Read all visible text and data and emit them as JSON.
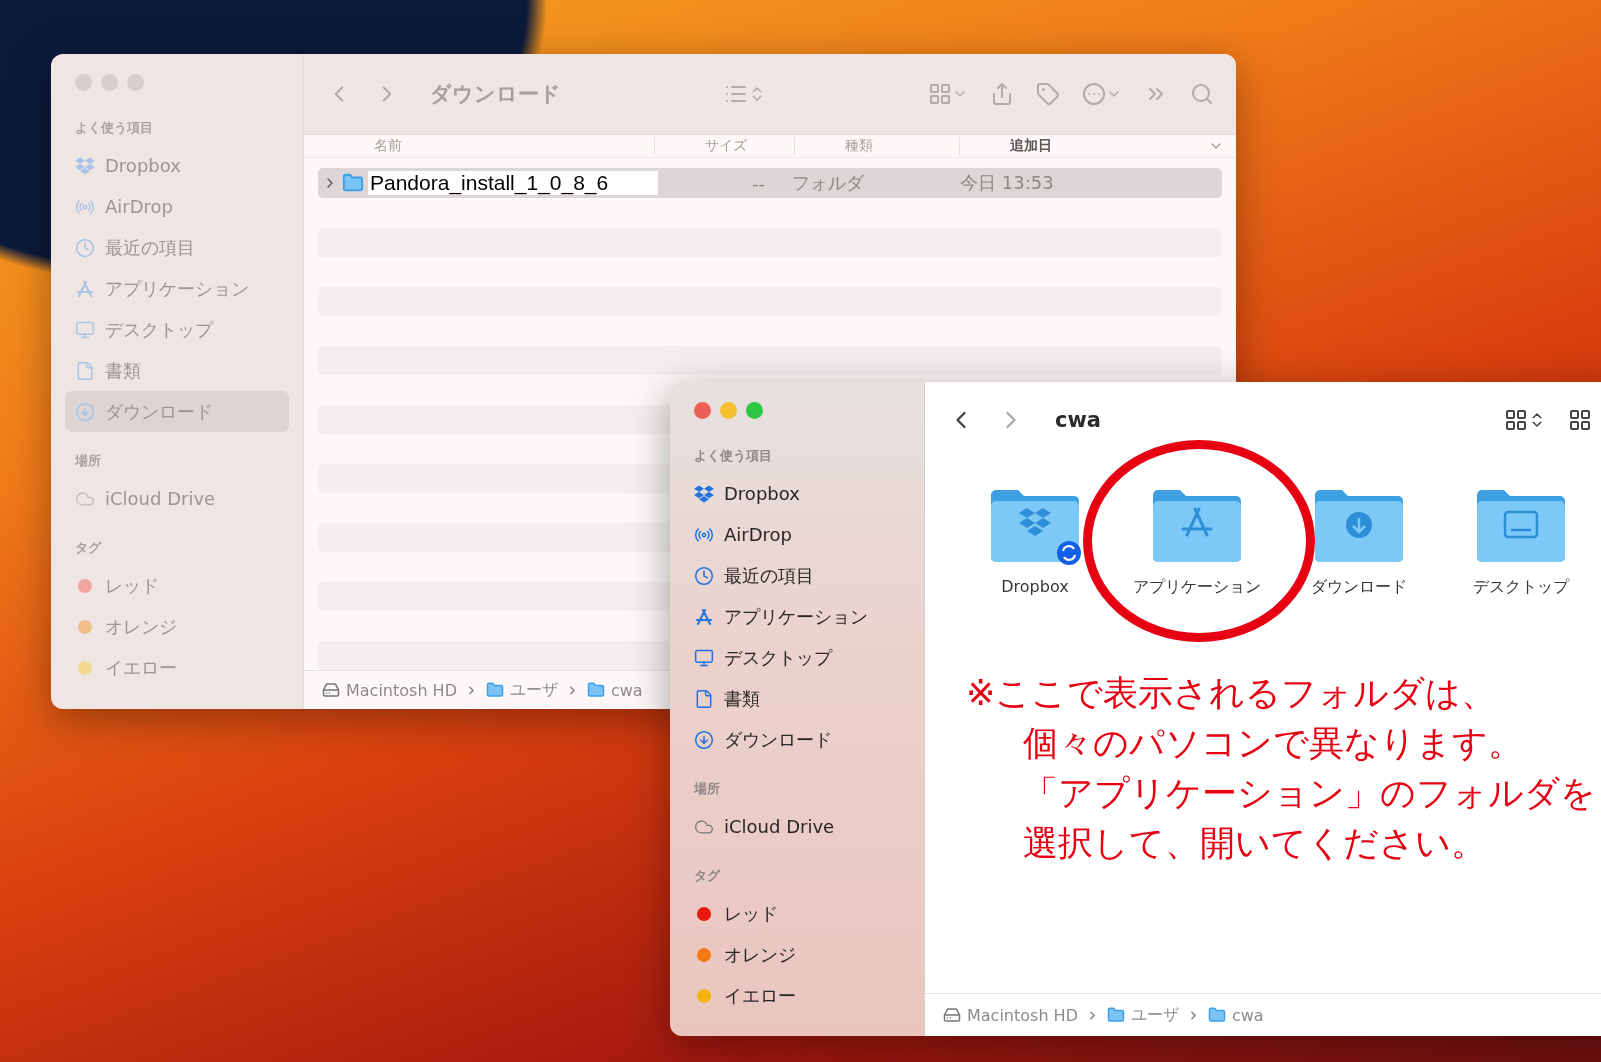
{
  "back_window": {
    "active": false,
    "title": "ダウンロード",
    "sidebar": [
      {
        "heading": "よく使う項目",
        "items": [
          {
            "label": "Dropbox",
            "kind": "dropbox",
            "selected": false
          },
          {
            "label": "AirDrop",
            "kind": "airdrop",
            "selected": false
          },
          {
            "label": "最近の項目",
            "kind": "recent",
            "selected": false
          },
          {
            "label": "アプリケーション",
            "kind": "apps",
            "selected": false
          },
          {
            "label": "デスクトップ",
            "kind": "desktop",
            "selected": false
          },
          {
            "label": "書類",
            "kind": "documents",
            "selected": false
          },
          {
            "label": "ダウンロード",
            "kind": "downloads",
            "selected": true
          }
        ]
      },
      {
        "heading": "場所",
        "items": [
          {
            "label": "iCloud Drive",
            "kind": "icloud",
            "selected": false
          }
        ]
      },
      {
        "heading": "タグ",
        "items": [
          {
            "label": "レッド",
            "kind": "tag",
            "color": "#f0a5a3",
            "selected": false
          },
          {
            "label": "オレンジ",
            "kind": "tag",
            "color": "#f2bd8a",
            "selected": false
          },
          {
            "label": "イエロー",
            "kind": "tag",
            "color": "#f1d88c",
            "selected": false
          }
        ]
      }
    ],
    "columns": [
      {
        "label": "名前",
        "sorted": false
      },
      {
        "label": "サイズ",
        "sorted": false
      },
      {
        "label": "種類",
        "sorted": false
      },
      {
        "label": "追加日",
        "sorted": true
      }
    ],
    "rows": [
      {
        "name": "Pandora_install_1_0_8_6",
        "size": "--",
        "type": "フォルダ",
        "added": "今日 13:53",
        "selected": true,
        "expanded": false
      }
    ],
    "path": [
      {
        "label": "Macintosh HD",
        "kind": "disk"
      },
      {
        "label": "ユーザ",
        "kind": "folder"
      },
      {
        "label": "cwa",
        "kind": "folder"
      }
    ]
  },
  "front_window": {
    "active": true,
    "title": "cwa",
    "sidebar": [
      {
        "heading": "よく使う項目",
        "items": [
          {
            "label": "Dropbox",
            "kind": "dropbox",
            "selected": false
          },
          {
            "label": "AirDrop",
            "kind": "airdrop",
            "selected": false
          },
          {
            "label": "最近の項目",
            "kind": "recent",
            "selected": false
          },
          {
            "label": "アプリケーション",
            "kind": "apps",
            "selected": false
          },
          {
            "label": "デスクトップ",
            "kind": "desktop",
            "selected": false
          },
          {
            "label": "書類",
            "kind": "documents",
            "selected": false
          },
          {
            "label": "ダウンロード",
            "kind": "downloads",
            "selected": false
          }
        ]
      },
      {
        "heading": "場所",
        "items": [
          {
            "label": "iCloud Drive",
            "kind": "icloud",
            "selected": false
          }
        ]
      },
      {
        "heading": "タグ",
        "items": [
          {
            "label": "レッド",
            "kind": "tag",
            "color": "#e8190f",
            "selected": false
          },
          {
            "label": "オレンジ",
            "kind": "tag",
            "color": "#f27a12",
            "selected": false
          },
          {
            "label": "イエロー",
            "kind": "tag",
            "color": "#f5b40f",
            "selected": false
          }
        ]
      }
    ],
    "icons": [
      {
        "label": "Dropbox",
        "kind": "dropbox",
        "syncing": true
      },
      {
        "label": "アプリケーション",
        "kind": "apps",
        "syncing": false
      },
      {
        "label": "ダウンロード",
        "kind": "downloads",
        "syncing": false
      },
      {
        "label": "デスクトップ",
        "kind": "desktop",
        "syncing": false
      }
    ],
    "path": [
      {
        "label": "Macintosh HD",
        "kind": "disk"
      },
      {
        "label": "ユーザ",
        "kind": "folder"
      },
      {
        "label": "cwa",
        "kind": "folder"
      }
    ]
  },
  "annotation": {
    "lines": [
      "※ここで表示されるフォルダは、",
      "個々のパソコンで異なります。",
      "「アプリケーション」のフォルダを",
      "選択して、開いてください。"
    ]
  }
}
